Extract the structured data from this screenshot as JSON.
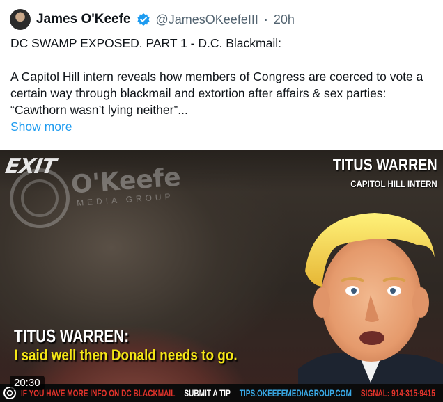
{
  "tweet": {
    "author_name": "James O'Keefe",
    "handle": "@JamesOKeefeIII",
    "separator": "·",
    "time": "20h",
    "text": "DC SWAMP EXPOSED. PART 1 - D.C. Blackmail:\n\nA Capitol Hill intern reveals how members of Congress are coerced to vote a certain way through blackmail and extortion after affairs & sex parties: “Cawthorn wasn’t lying neither”...",
    "show_more": "Show more",
    "verified_color": "#1d9bf0"
  },
  "video": {
    "exit_sign": "EXIT",
    "watermark_brand": "O'Keefe",
    "watermark_sub": "MEDIA GROUP",
    "person_name": "TITUS WARREN",
    "person_title": "CAPITOL HILL INTERN",
    "caption_speaker": "TITUS WARREN:",
    "caption_quote": "I said well then Donald needs to go.",
    "duration": "20:30",
    "ticker": {
      "tip_text": "IF YOU HAVE MORE INFO ON DC BLACKMAIL",
      "submit": "SUBMIT A TIP",
      "url": "TIPS.OKEEFEMEDIAGROUP.COM",
      "signal": "SIGNAL: 914-315-9415"
    }
  }
}
